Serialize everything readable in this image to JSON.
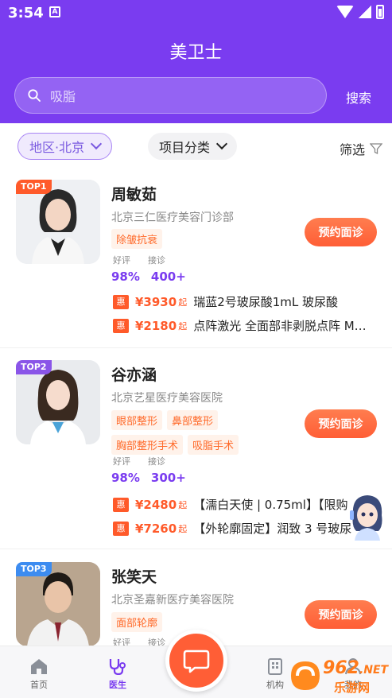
{
  "status_bar": {
    "time": "3:54",
    "a_icon": "A"
  },
  "header": {
    "title": "美卫士",
    "search_placeholder": "吸脂",
    "search_button": "搜索"
  },
  "filters": {
    "region": "地区·北京",
    "category": "项目分类",
    "filter": "筛选"
  },
  "stat_labels": {
    "rating": "好评",
    "consults": "接诊"
  },
  "book_label": "预约面诊",
  "price_suffix": "起",
  "deal_badge": "惠",
  "doctors": [
    {
      "rank": "TOP1",
      "rank_color": "#ff5a2a",
      "name": "周敏茹",
      "hospital": "北京三仁医疗美容门诊部",
      "tags": [
        "除皱抗衰"
      ],
      "rating": "98%",
      "consults": "400+",
      "deals": [
        {
          "price": "¥3930",
          "desc": "瑞蓝2号玻尿酸1mL 玻尿酸"
        },
        {
          "price": "¥2180",
          "desc": "点阵激光 全面部非剥脱点阵 M…"
        }
      ]
    },
    {
      "rank": "TOP2",
      "rank_color": "#8a55e8",
      "name": "谷亦涵",
      "hospital": "北京艺星医疗美容医院",
      "tags": [
        "眼部整形",
        "鼻部整形",
        "胸部整形手术",
        "吸脂手术"
      ],
      "rating": "98%",
      "consults": "300+",
      "deals": [
        {
          "price": "¥2480",
          "desc": "【濡白天使 | 0.75ml】【限购"
        },
        {
          "price": "¥7260",
          "desc": "【外轮廓固定】润致 3 号玻尿"
        }
      ]
    },
    {
      "rank": "TOP3",
      "rank_color": "#3d8cf0",
      "name": "张笑天",
      "hospital": "北京圣嘉新医疗美容医院",
      "tags": [
        "面部轮廓"
      ],
      "rating": "",
      "consults": "",
      "deals": []
    }
  ],
  "bottom_nav": {
    "home": "首页",
    "doctor": "医生",
    "institution": "机构",
    "mine": "我的"
  },
  "watermark": {
    "brand": "962",
    "domain_text": "乐游网",
    "site": ".NET"
  },
  "colors": {
    "primary": "#7a3cf0",
    "accent": "#ff5e36"
  }
}
